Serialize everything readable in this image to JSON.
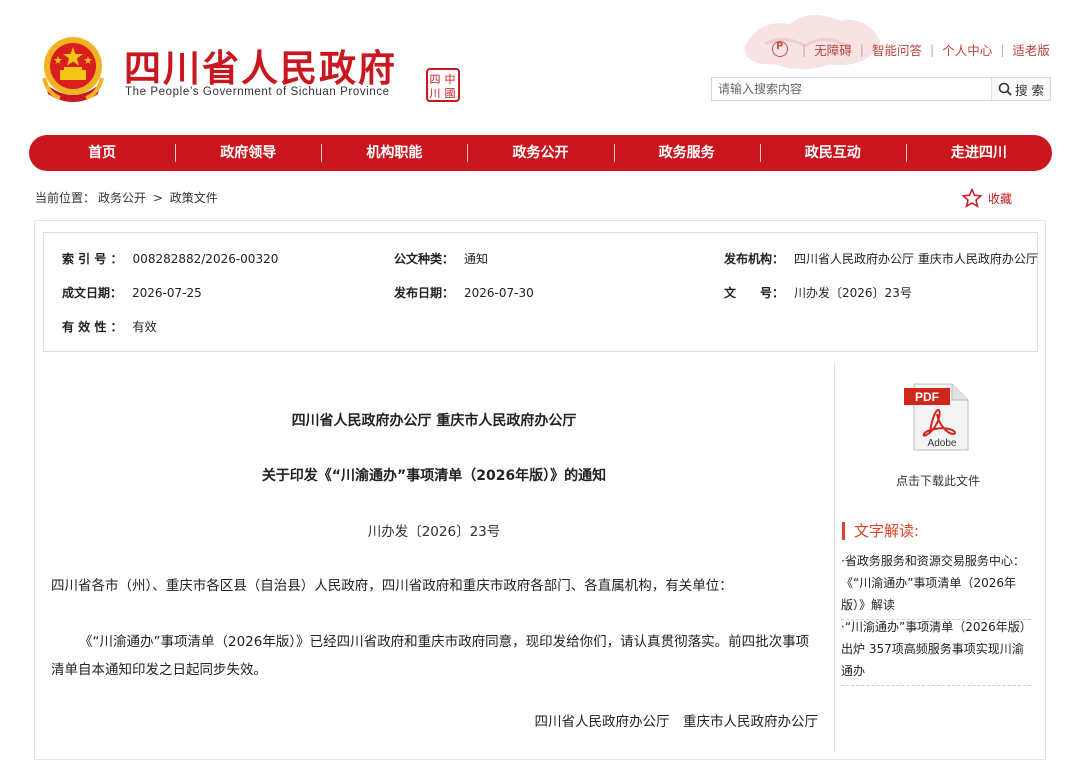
{
  "header": {
    "logo_cn": "四川省人民政府",
    "logo_en": "The People’s Government of Sichuan Province",
    "seal_chars": [
      "四",
      "中",
      "川",
      "國"
    ]
  },
  "toplinks": {
    "accessibility": "无障碍",
    "qa": "智能问答",
    "personal": "个人中心",
    "elderly": "适老版"
  },
  "search": {
    "placeholder": "请输入搜索内容",
    "button": "搜 索"
  },
  "nav": {
    "items": [
      "首页",
      "政府领导",
      "机构职能",
      "政务公开",
      "政务服务",
      "政民互动",
      "走进四川"
    ]
  },
  "breadcrumb": {
    "prefix": "当前位置：",
    "level1": "政务公开",
    "sep": ">",
    "level2": "政策文件"
  },
  "favorite": {
    "label": "收藏"
  },
  "meta": {
    "index_no_label": "索 引 号 ：",
    "index_no": "008282882/2026-00320",
    "doc_type_label": "公文种类：",
    "doc_type": "通知",
    "issuer_label": "发布机构：",
    "issuer": "四川省人民政府办公厅 重庆市人民政府办公厅",
    "created_label": "成文日期：",
    "created": "2026-07-25",
    "published_label": "发布日期：",
    "published": "2026-07-30",
    "docno_label": "文　　号：",
    "docno": "川办发〔2026〕23号",
    "validity_label": "有 效 性 ：",
    "validity": "有效"
  },
  "article": {
    "title1": "四川省人民政府办公厅 重庆市人民政府办公厅",
    "title2": "关于印发《“川渝通办”事项清单（2026年版）》的通知",
    "doc_no": "川办发〔2026〕23号",
    "p1": "四川省各市（州）、重庆市各区县（自治县）人民政府，四川省政府和重庆市政府各部门、各直属机构，有关单位：",
    "p2": "《“川渝通办”事项清单（2026年版）》已经四川省政府和重庆市政府同意，现印发给你们，请认真贯彻落实。前四批次事项清单自本通知印发之日起同步失效。",
    "signature": "四川省人民政府办公厅　重庆市人民政府办公厅"
  },
  "sidebar": {
    "pdf_text": "PDF",
    "pdf_brand": "Adobe",
    "download_label": "点击下载此文件",
    "interpretation_title": "文字解读:",
    "items": [
      "·省政务服务和资源交易服务中心：《“川渝通办”事项清单（2026年版）》解读",
      "·“川渝通办”事项清单（2026年版）出炉 357项高频服务事项实现川渝通办"
    ]
  },
  "colors": {
    "brand_red": "#c9151e",
    "link_red": "#b9423a",
    "accent_orange": "#d8452a"
  }
}
